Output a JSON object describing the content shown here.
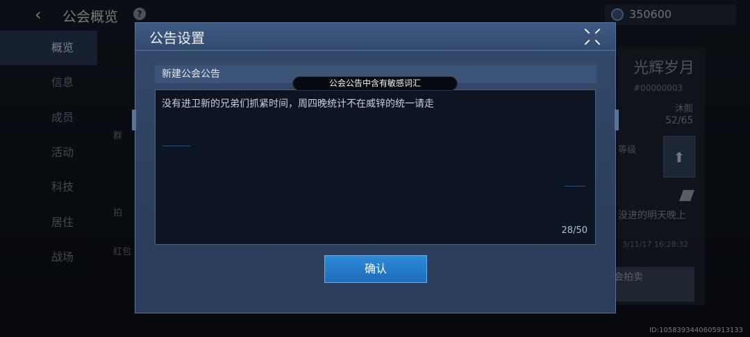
{
  "app": {
    "page_title": "公会概览",
    "currency_value": "350600",
    "uid": "ID:1058393440605913133"
  },
  "sidebar": {
    "items": [
      {
        "label": "概览"
      },
      {
        "label": "信息"
      },
      {
        "label": "成员"
      },
      {
        "label": "活动"
      },
      {
        "label": "科技"
      },
      {
        "label": "居住"
      },
      {
        "label": "战场"
      }
    ]
  },
  "background_panel": {
    "guild_name": "光辉岁月",
    "guild_id": "#00000003",
    "leader": "沐熙",
    "member_count": "52/65",
    "level_label": "等级",
    "notice_preview": "没进的明天晚上",
    "notice_time": "3/11/17 16:28:32",
    "auction_label": "会拍卖",
    "left_texts": [
      "群",
      "拍",
      "红包"
    ]
  },
  "dialog": {
    "title": "公告设置",
    "section_label": "新建公会公告",
    "text_value": "没有进卫新的兄弟们抓紧时间，周四晚统计不在威锌的统一请走",
    "char_count": "28/50",
    "confirm_label": "确认"
  },
  "toast": {
    "message": "公会公告中含有敏感词汇"
  }
}
